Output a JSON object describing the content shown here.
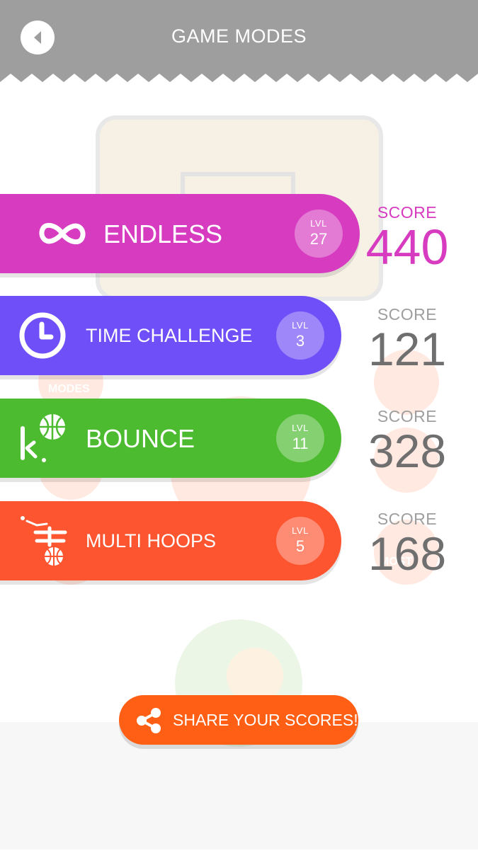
{
  "header": {
    "title": "GAME MODES",
    "back_icon": "back-arrow-icon",
    "color": "#9e9e9e"
  },
  "modes": [
    {
      "icon": "infinity-icon",
      "label": "ENDLESS",
      "level_label": "LVL",
      "level": "27",
      "score_label": "SCORE",
      "score": "440",
      "color": "#d63bc0",
      "selected": true
    },
    {
      "icon": "clock-icon",
      "label": "TIME CHALLENGE",
      "level_label": "LVL",
      "level": "3",
      "score_label": "SCORE",
      "score": "121",
      "color": "#6f4ff7",
      "selected": false
    },
    {
      "icon": "bounce-basketball-icon",
      "label": "BOUNCE",
      "level_label": "LVL",
      "level": "11",
      "score_label": "SCORE",
      "score": "328",
      "color": "#4cbb30",
      "selected": false
    },
    {
      "icon": "multi-hoops-icon",
      "label": "MULTI HOOPS",
      "level_label": "LVL",
      "level": "5",
      "score_label": "SCORE",
      "score": "168",
      "color": "#fe5531",
      "selected": false
    }
  ],
  "share": {
    "label": "SHARE YOUR SCORES!",
    "icon": "share-icon",
    "color": "#ff5f14"
  },
  "background": {
    "modes_text": "MODES",
    "most_text": "MOST"
  }
}
